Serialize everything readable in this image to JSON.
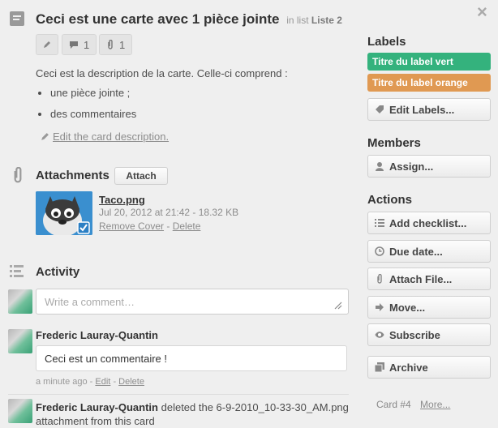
{
  "card": {
    "title": "Ceci est une carte avec 1 pièce jointe",
    "in_list_prefix": "in list",
    "list_name": "Liste 2",
    "comments_count": "1",
    "attachments_count": "1"
  },
  "description": {
    "text": "Ceci est la description de la carte. Celle-ci comprend :",
    "items": [
      "une pièce jointe ;",
      "des commentaires"
    ],
    "edit_link": "Edit the card description."
  },
  "attachments": {
    "title": "Attachments",
    "attach_button": "Attach",
    "file": {
      "name": "Taco.png",
      "meta": "Jul 20, 2012 at 21:42 - 18.32 KB",
      "remove_cover": "Remove Cover",
      "separator": "-",
      "delete": "Delete"
    }
  },
  "activity": {
    "title": "Activity",
    "comment_placeholder": "Write a comment…",
    "comment": {
      "author": "Frederic Lauray-Quantin",
      "text": "Ceci est un commentaire !",
      "time": "a minute ago",
      "edit": "Edit",
      "delete": "Delete"
    },
    "event": {
      "author": "Frederic Lauray-Quantin",
      "text": "deleted the 6-9-2010_10-33-30_AM.png",
      "text2": "attachment from this card"
    }
  },
  "sidebar": {
    "labels_title": "Labels",
    "labels": [
      {
        "name": "Titre du label vert",
        "color": "#34b27d"
      },
      {
        "name": "Titre du label orange",
        "color": "#e09952"
      }
    ],
    "edit_labels": "Edit Labels...",
    "members_title": "Members",
    "assign": "Assign...",
    "actions_title": "Actions",
    "actions": {
      "checklist": "Add checklist...",
      "due": "Due date...",
      "attach": "Attach File...",
      "move": "Move...",
      "subscribe": "Subscribe",
      "archive": "Archive"
    },
    "card_number": "Card #4",
    "more": "More..."
  },
  "close_glyph": "×",
  "dash": "-"
}
